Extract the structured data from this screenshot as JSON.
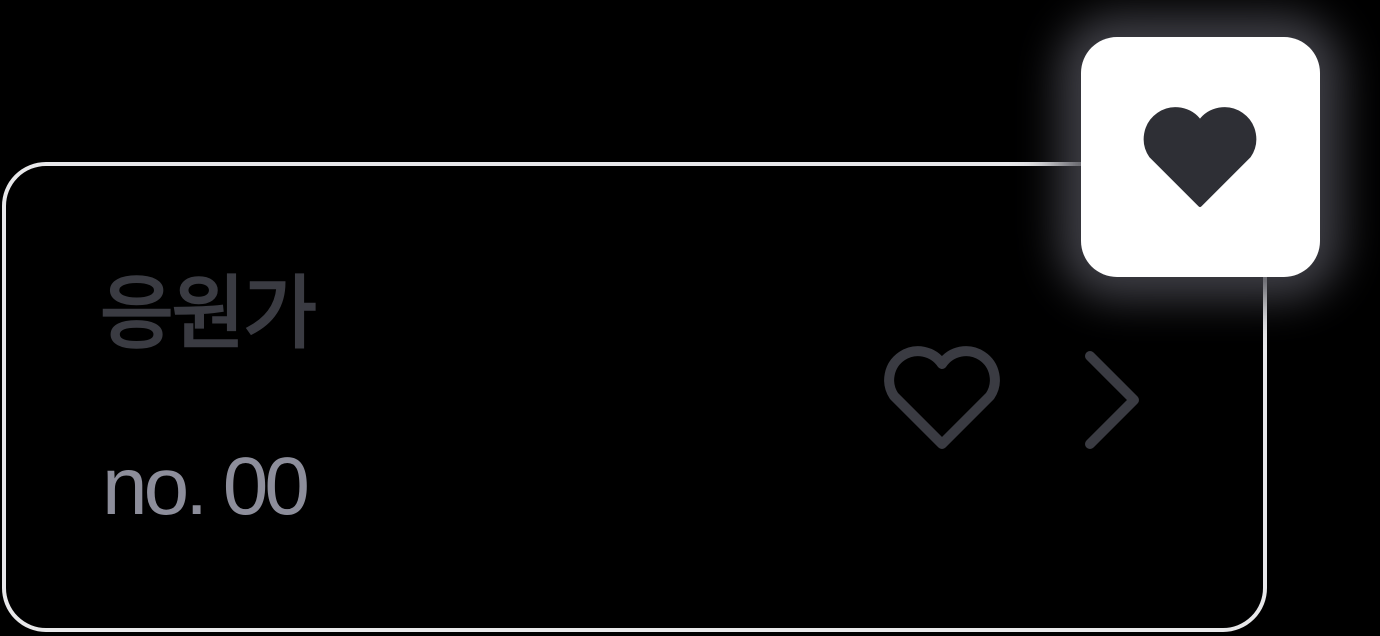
{
  "card": {
    "title": "응원가",
    "number": "no. 00"
  },
  "icons": {
    "favorite": "heart-outline-icon",
    "navigate": "chevron-right-icon",
    "popup": "heart-filled-icon"
  },
  "colors": {
    "background": "#000000",
    "card_border": "#e8e8ea",
    "title_text": "#3a3b42",
    "number_text": "#8d8e9b",
    "icon_stroke": "#3a3b42",
    "popup_background": "#ffffff",
    "popup_heart": "#2e2f35"
  }
}
